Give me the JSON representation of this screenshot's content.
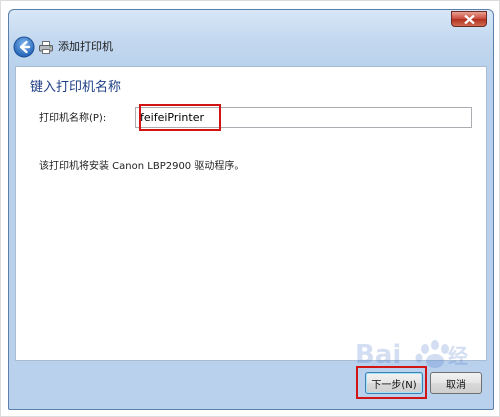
{
  "window": {
    "title": "添加打印机"
  },
  "page": {
    "heading": "键入打印机名称",
    "name_label": "打印机名称(P):",
    "name_value": "feifeiPrinter",
    "info": "该打印机将安装 Canon LBP2900 驱动程序。"
  },
  "footer": {
    "next_label": "下一步(N)",
    "cancel_label": "取消"
  },
  "icons": {
    "back": "back-arrow-icon",
    "printer": "printer-icon",
    "close": "close-icon"
  },
  "colors": {
    "heading": "#1e3f86",
    "highlight": "#d11515",
    "chrome": "#c4d9f0"
  }
}
